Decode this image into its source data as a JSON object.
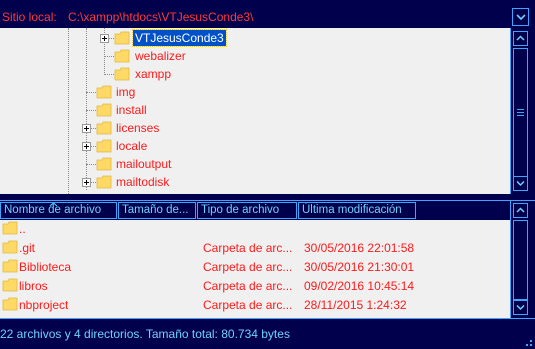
{
  "site_bar": {
    "label": "Sitio local:",
    "path": "C:\\xampp\\htdocs\\VTJesusConde3\\"
  },
  "tree": {
    "items": [
      {
        "label": "VTJesusConde3",
        "selected": true,
        "expandable": true
      },
      {
        "label": "webalizer",
        "selected": false,
        "expandable": false
      },
      {
        "label": "xampp",
        "selected": false,
        "expandable": false
      },
      {
        "label": "img",
        "selected": false,
        "expandable": false
      },
      {
        "label": "install",
        "selected": false,
        "expandable": false
      },
      {
        "label": "licenses",
        "selected": false,
        "expandable": true
      },
      {
        "label": "locale",
        "selected": false,
        "expandable": true
      },
      {
        "label": "mailoutput",
        "selected": false,
        "expandable": false
      },
      {
        "label": "mailtodisk",
        "selected": false,
        "expandable": true
      }
    ]
  },
  "file_list": {
    "columns": [
      "Nombre de archivo",
      "Tamaño de...",
      "Tipo de archivo",
      "Última modificación"
    ],
    "rows": [
      {
        "name": "..",
        "size": "",
        "type": "",
        "modified": ""
      },
      {
        "name": ".git",
        "size": "",
        "type": "Carpeta de arc...",
        "modified": "30/05/2016 22:01:58"
      },
      {
        "name": "Biblioteca",
        "size": "",
        "type": "Carpeta de arc...",
        "modified": "30/05/2016 21:30:01"
      },
      {
        "name": "libros",
        "size": "",
        "type": "Carpeta de arc...",
        "modified": "09/02/2016 10:45:14"
      },
      {
        "name": "nbproject",
        "size": "",
        "type": "Carpeta de arc...",
        "modified": "28/11/2015 1:24:32"
      }
    ]
  },
  "status": {
    "text": "22 archivos y 4 directorios. Tamaño total: 80.734 bytes"
  },
  "colors": {
    "theme_background": "#00004d",
    "accent_border": "#3aa6ff",
    "text_red": "#ff1a1a",
    "header_text": "#6fd0ff",
    "pane_background": "#f0f0f0",
    "selection": "#0050c8",
    "folder": "#ffd966"
  },
  "icons": {
    "folder": "folder-icon",
    "expand": "plus-expander-icon",
    "scroll_up": "arrow-up-icon",
    "scroll_down": "arrow-down-icon",
    "dropdown": "chevron-down-icon",
    "sort": "sort-arrow-icon",
    "resize": "resize-grip-icon"
  }
}
